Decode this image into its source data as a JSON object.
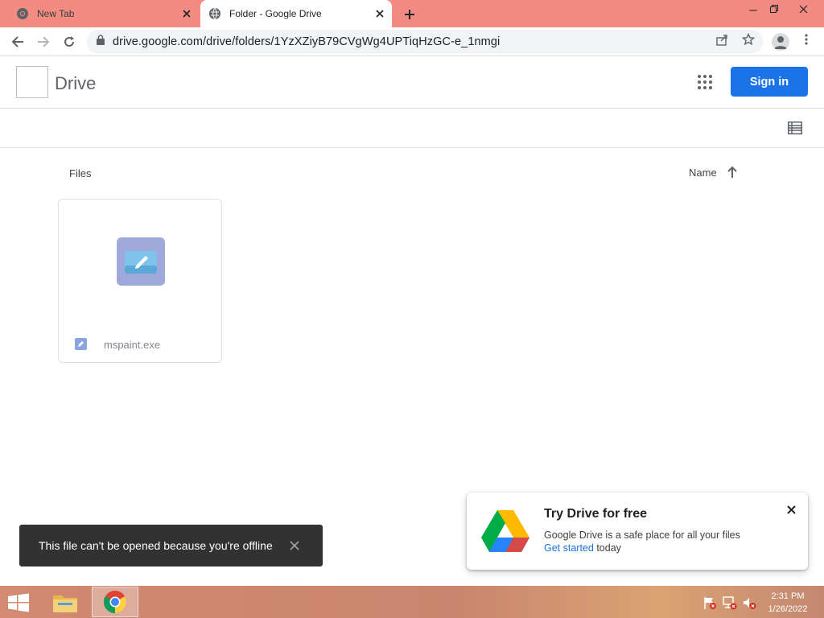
{
  "browser": {
    "tabs": [
      {
        "title": "New Tab",
        "active": false,
        "icon": "chrome-icon"
      },
      {
        "title": "Folder - Google Drive",
        "active": true,
        "icon": "globe-icon"
      }
    ],
    "url": "drive.google.com/drive/folders/1YzXZiyB79CVgWg4UPTiqHzGC-e_1nmgi",
    "tabstrip_color": "#f28b82"
  },
  "drive": {
    "title": "Drive",
    "signin_label": "Sign in",
    "files_label": "Files",
    "sort_label": "Name",
    "accent": "#1a73e8"
  },
  "files": [
    {
      "name": "mspaint.exe",
      "icon": "edit-pencil-icon"
    }
  ],
  "snackbar": {
    "message": "This file can't be opened because you're offline"
  },
  "promo": {
    "title": "Try Drive for free",
    "body": "Google Drive is a safe place for all your files",
    "link": "Get started",
    "suffix": " today"
  },
  "taskbar": {
    "time": "2:31 PM",
    "date": "1/26/2022"
  }
}
